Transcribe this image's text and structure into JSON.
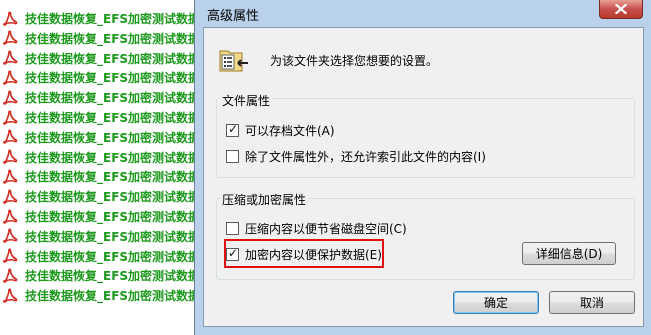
{
  "file_list": {
    "items": [
      "技佳数据恢复_EFS加密测试数据",
      "技佳数据恢复_EFS加密测试数据",
      "技佳数据恢复_EFS加密测试数据",
      "技佳数据恢复_EFS加密测试数据",
      "技佳数据恢复_EFS加密测试数据",
      "技佳数据恢复_EFS加密测试数据",
      "技佳数据恢复_EFS加密测试数据",
      "技佳数据恢复_EFS加密测试数据",
      "技佳数据恢复_EFS加密测试数据",
      "技佳数据恢复_EFS加密测试数据",
      "技佳数据恢复_EFS加密测试数据",
      "技佳数据恢复_EFS加密测试数据",
      "技佳数据恢复_EFS加密测试数据",
      "技佳数据恢复_EFS加密测试数据",
      "技佳数据恢复_EFS加密测试数据"
    ],
    "icon": "pdf-file-icon",
    "text_color": "#1e9a1e"
  },
  "dialog": {
    "title": "高级属性",
    "header_text": "为该文件夹选择您想要的设置。",
    "file_attributes": {
      "title": "文件属性",
      "archive_label": "可以存档文件(A)",
      "archive_checked": true,
      "index_label": "除了文件属性外，还允许索引此文件的内容(I)",
      "index_checked": false
    },
    "compress_encrypt": {
      "title": "压缩或加密属性",
      "compress_label": "压缩内容以便节省磁盘空间(C)",
      "compress_checked": false,
      "encrypt_label": "加密内容以便保护数据(E)",
      "encrypt_checked": true,
      "details_button": "详细信息(D)"
    },
    "ok_button": "确定",
    "cancel_button": "取消"
  },
  "colors": {
    "highlight": "#e01010",
    "window_frame": "#b9d1ea"
  }
}
